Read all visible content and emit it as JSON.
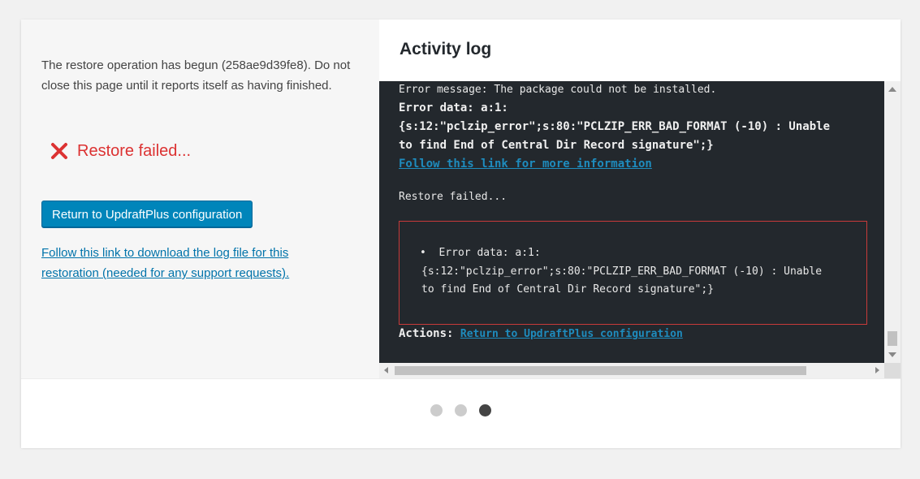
{
  "card": {
    "left": {
      "message": "The restore operation has begun (258ae9d39fe8). Do not close this page until it reports itself as having finished.",
      "status_text": "Restore failed...",
      "return_button": "Return to UpdraftPlus configuration",
      "download_link": "Follow this link to download the log file for this restoration (needed for any support requests)."
    },
    "right": {
      "title": "Activity log",
      "console": {
        "line1": "Error message: The package could not be installed.",
        "line2": "Error data: a:1:",
        "line3": "{s:12:\"pclzip_error\";s:80:\"PCLZIP_ERR_BAD_FORMAT (-10) : Unable",
        "line4": "to find End of Central Dir Record signature\";}",
        "more_info_link": "Follow this link for more information",
        "restore_failed": "Restore failed...",
        "box_line1": "Error data: a:1:",
        "box_line2": "{s:12:\"pclzip_error\";s:80:\"PCLZIP_ERR_BAD_FORMAT (-10) : Unable",
        "box_line3": "to find End of Central Dir Record signature\";}",
        "actions_label": "Actions:",
        "actions_link": "Return to UpdraftPlus configuration"
      }
    }
  },
  "pager": {
    "total": 3,
    "active": 3
  },
  "colors": {
    "error": "#dc3232",
    "button": "#0085ba",
    "link": "#0073aa",
    "console_bg": "#23282d"
  }
}
